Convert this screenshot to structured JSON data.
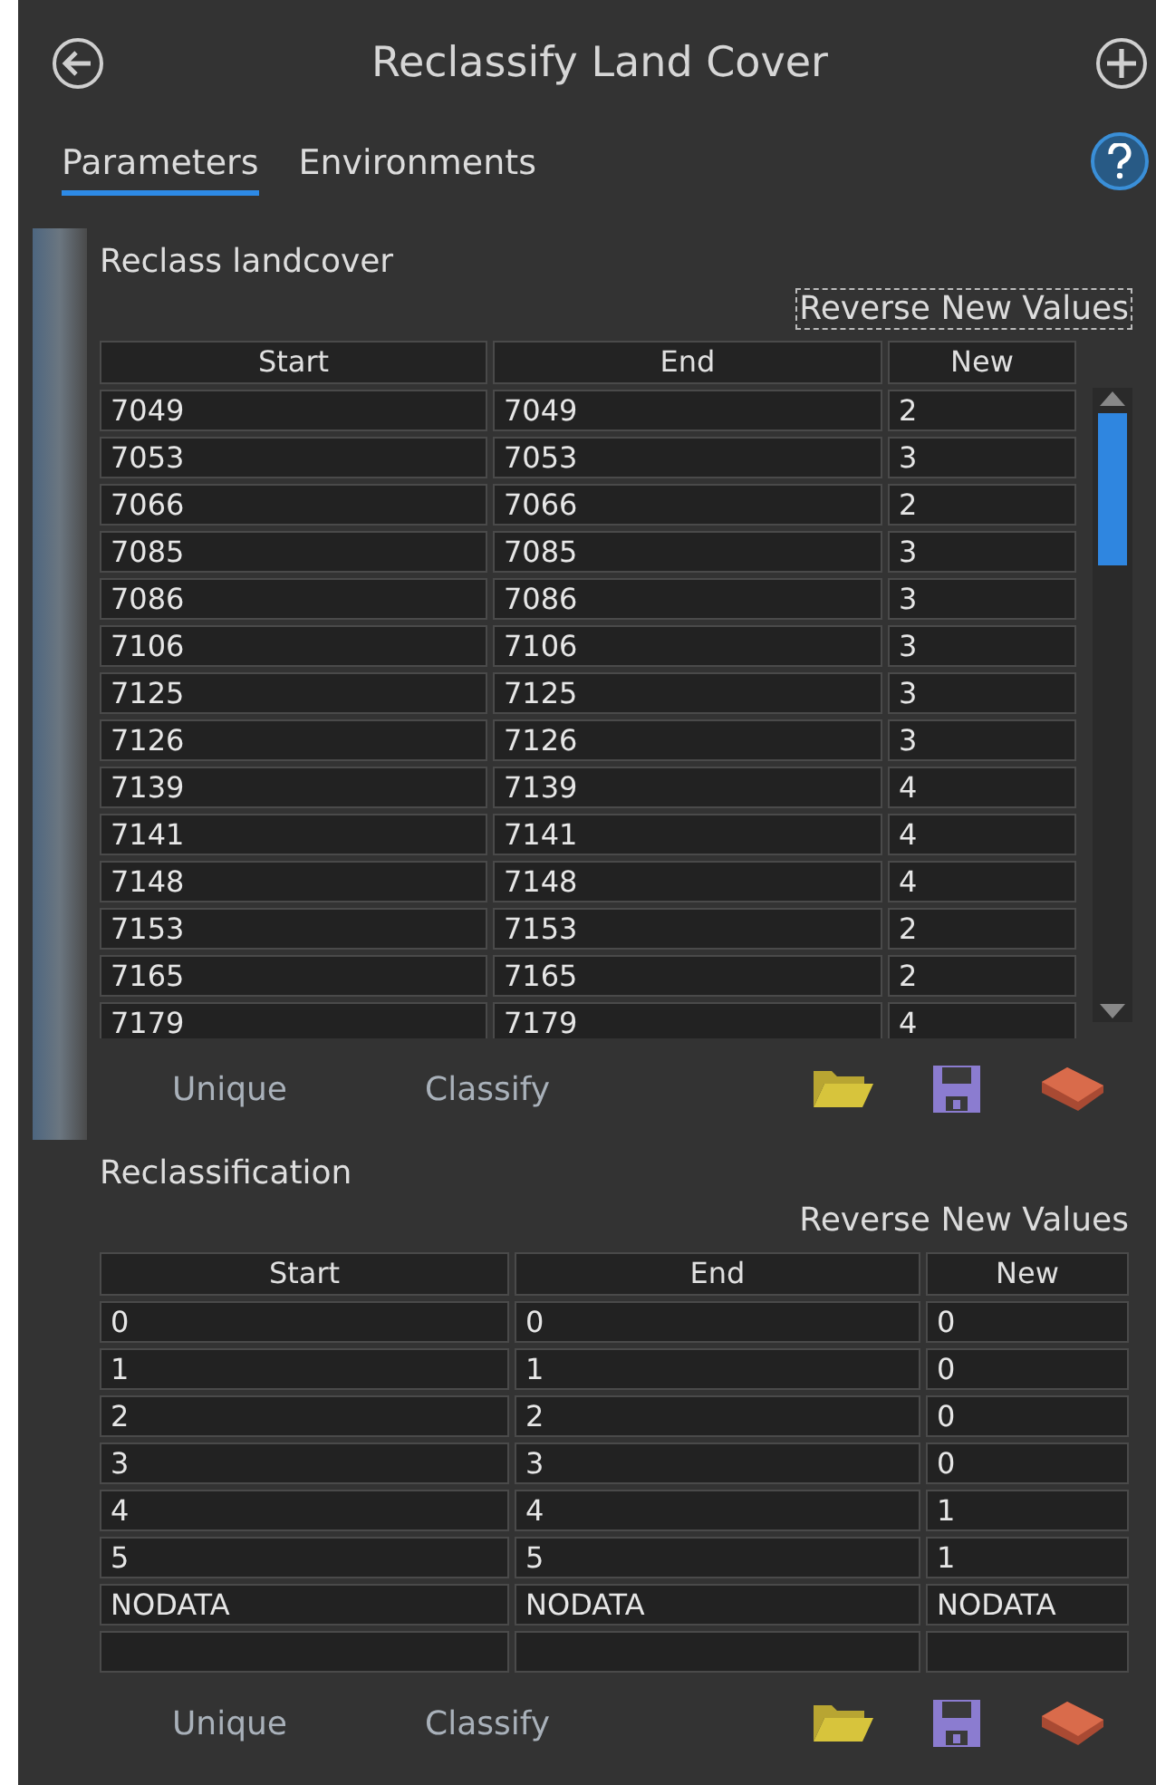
{
  "header": {
    "title": "Reclassify Land Cover"
  },
  "tabs": [
    {
      "label": "Parameters",
      "selected": true
    },
    {
      "label": "Environments",
      "selected": false
    }
  ],
  "parameters": [
    {
      "label": "Reclass landcover",
      "selected": true,
      "reverse_button": {
        "label": "Reverse New Values",
        "focused": true
      },
      "scrollable": true,
      "new_row": false,
      "columns": [
        "Start",
        "End",
        "New"
      ],
      "rows": [
        [
          "7049",
          "7049",
          "2"
        ],
        [
          "7053",
          "7053",
          "3"
        ],
        [
          "7066",
          "7066",
          "2"
        ],
        [
          "7085",
          "7085",
          "3"
        ],
        [
          "7086",
          "7086",
          "3"
        ],
        [
          "7106",
          "7106",
          "3"
        ],
        [
          "7125",
          "7125",
          "3"
        ],
        [
          "7126",
          "7126",
          "3"
        ],
        [
          "7139",
          "7139",
          "4"
        ],
        [
          "7141",
          "7141",
          "4"
        ],
        [
          "7148",
          "7148",
          "4"
        ],
        [
          "7153",
          "7153",
          "2"
        ],
        [
          "7165",
          "7165",
          "2"
        ],
        [
          "7179",
          "7179",
          "4"
        ]
      ],
      "buttons": [
        "Unique",
        "Classify"
      ]
    },
    {
      "label": "Reclassification",
      "selected": false,
      "reverse_button": {
        "label": "Reverse New Values",
        "focused": false
      },
      "scrollable": false,
      "new_row": true,
      "columns": [
        "Start",
        "End",
        "New"
      ],
      "rows": [
        [
          "0",
          "0",
          "0"
        ],
        [
          "1",
          "1",
          "0"
        ],
        [
          "2",
          "2",
          "0"
        ],
        [
          "3",
          "3",
          "0"
        ],
        [
          "4",
          "4",
          "1"
        ],
        [
          "5",
          "5",
          "1"
        ],
        [
          "NODATA",
          "NODATA",
          "NODATA"
        ]
      ],
      "buttons": [
        "Unique",
        "Classify"
      ]
    }
  ]
}
